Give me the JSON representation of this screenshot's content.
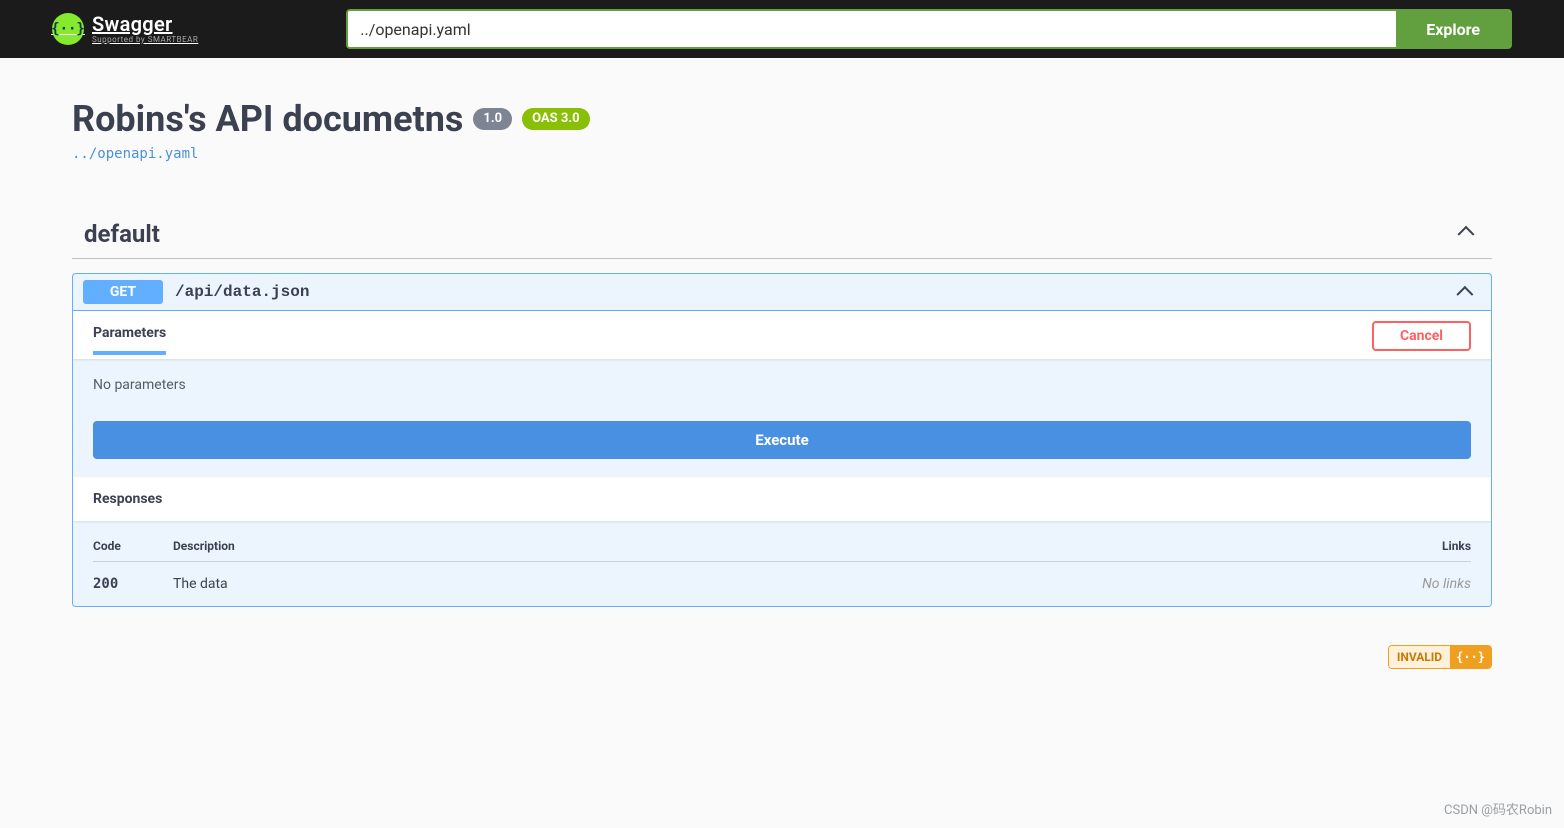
{
  "topbar": {
    "logo_main": "Swagger",
    "logo_sub": "Supported by SMARTBEAR",
    "logo_glyph": "{··}",
    "url_value": "../openapi.yaml",
    "explore_label": "Explore"
  },
  "info": {
    "title": "Robins's API documetns",
    "version": "1.0",
    "oas_label": "OAS 3.0",
    "yaml_link": "../openapi.yaml"
  },
  "tag": {
    "name": "default"
  },
  "operation": {
    "method": "GET",
    "path": "/api/data.json",
    "parameters_tab": "Parameters",
    "cancel_label": "Cancel",
    "no_params": "No parameters",
    "execute_label": "Execute",
    "responses_label": "Responses",
    "headers": {
      "code": "Code",
      "description": "Description",
      "links": "Links"
    },
    "response": {
      "code": "200",
      "description": "The data",
      "links": "No links"
    }
  },
  "footer": {
    "invalid_label": "INVALID",
    "invalid_icon": "{··}"
  },
  "watermark": "CSDN @码农Robin"
}
